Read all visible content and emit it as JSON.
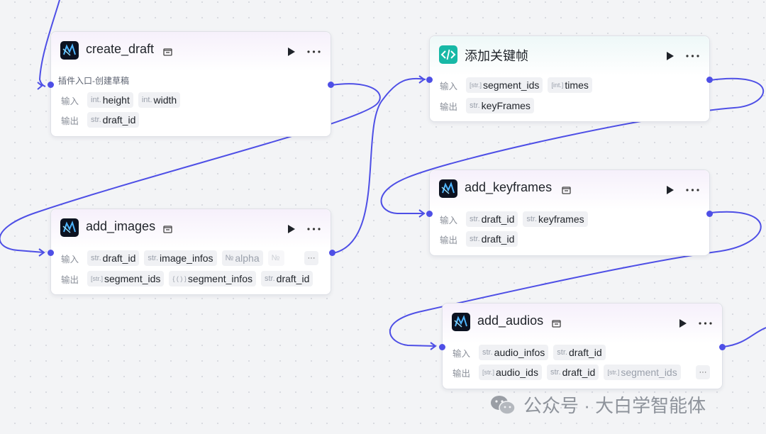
{
  "canvas": {
    "accent_color": "#4e4fe6",
    "background_color": "#f3f4f6"
  },
  "nodes": {
    "create_draft": {
      "title": "create_draft",
      "icon": "capcut-plugin-icon",
      "description": "插件入口-创建草稿",
      "input_label": "输入",
      "output_label": "输出",
      "inputs": [
        {
          "type": "int.",
          "name": "height"
        },
        {
          "type": "int.",
          "name": "width"
        }
      ],
      "outputs": [
        {
          "type": "str.",
          "name": "draft_id"
        }
      ]
    },
    "add_images": {
      "title": "add_images",
      "icon": "capcut-plugin-icon",
      "input_label": "输入",
      "output_label": "输出",
      "inputs": [
        {
          "type": "str.",
          "name": "draft_id"
        },
        {
          "type": "str.",
          "name": "image_infos"
        },
        {
          "type": "№",
          "name": "alpha"
        },
        {
          "type": "№",
          "name": ""
        }
      ],
      "outputs": [
        {
          "type": "[str.]",
          "name": "segment_ids"
        },
        {
          "type": "{ ( ) }",
          "name": "segment_infos"
        },
        {
          "type": "str.",
          "name": "draft_id"
        }
      ],
      "overflow": "···"
    },
    "add_keyframe_cn": {
      "title": "添加关键帧",
      "icon": "code-icon",
      "input_label": "输入",
      "output_label": "输出",
      "inputs": [
        {
          "type": "[str.]",
          "name": "segment_ids"
        },
        {
          "type": "[int.]",
          "name": "times"
        }
      ],
      "outputs": [
        {
          "type": "str.",
          "name": "keyFrames"
        }
      ]
    },
    "add_keyframes": {
      "title": "add_keyframes",
      "icon": "capcut-plugin-icon",
      "input_label": "输入",
      "output_label": "输出",
      "inputs": [
        {
          "type": "str.",
          "name": "draft_id"
        },
        {
          "type": "str.",
          "name": "keyframes"
        }
      ],
      "outputs": [
        {
          "type": "str.",
          "name": "draft_id"
        }
      ]
    },
    "add_audios": {
      "title": "add_audios",
      "icon": "capcut-plugin-icon",
      "input_label": "输入",
      "output_label": "输出",
      "inputs": [
        {
          "type": "str.",
          "name": "audio_infos"
        },
        {
          "type": "str.",
          "name": "draft_id"
        }
      ],
      "outputs": [
        {
          "type": "[str.]",
          "name": "audio_ids"
        },
        {
          "type": "str.",
          "name": "draft_id"
        },
        {
          "type": "[str.]",
          "name": "segment_ids"
        }
      ],
      "overflow": "···"
    }
  },
  "watermark": {
    "text": "公众号 · 大白学智能体",
    "icon": "wechat-icon"
  }
}
